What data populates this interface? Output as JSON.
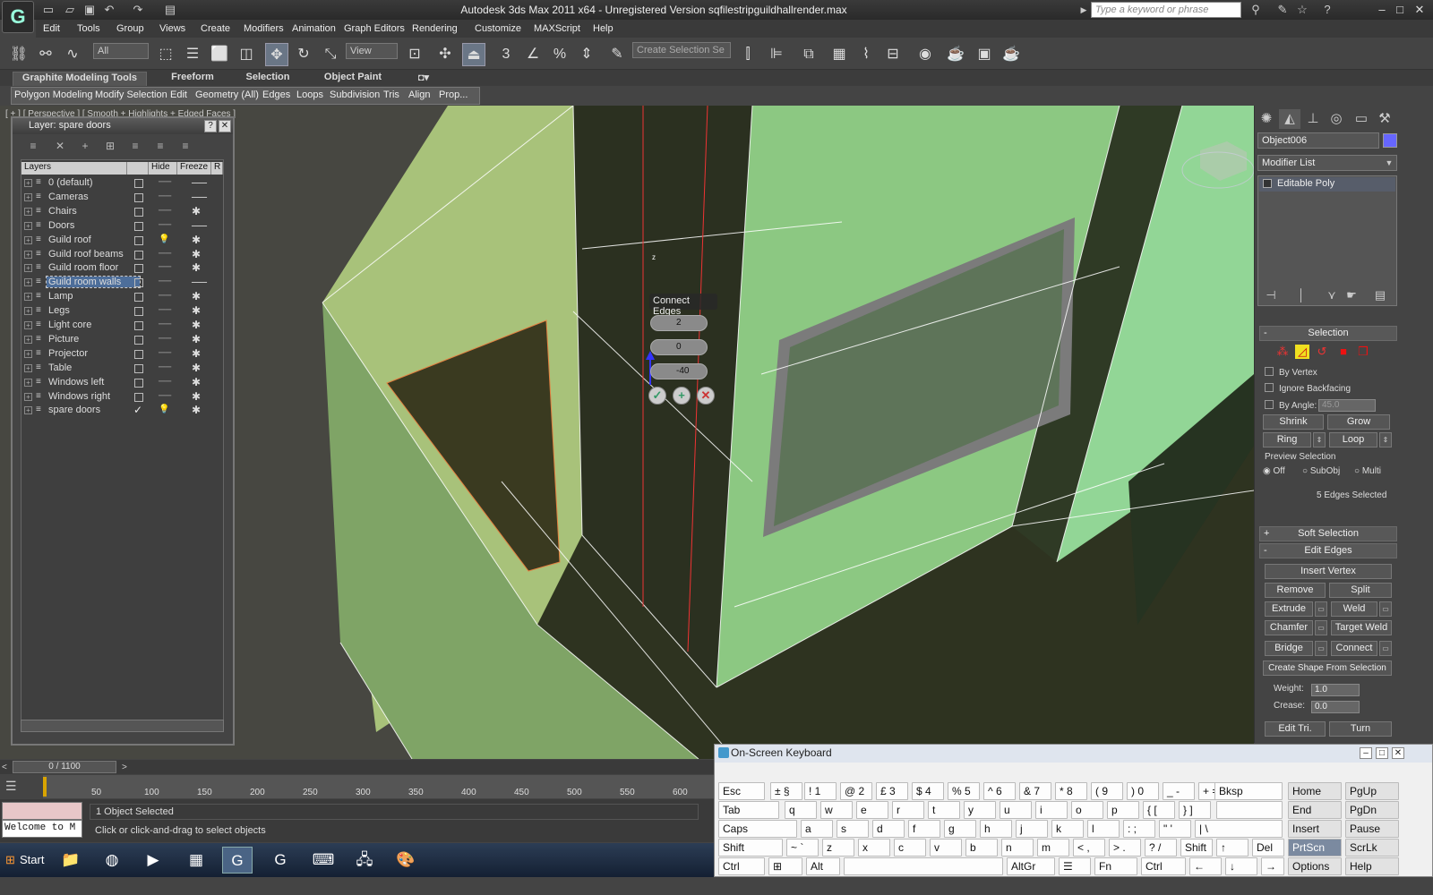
{
  "titlebar": {
    "title": "Autodesk 3ds Max  2011 x64  - Unregistered Version   sqfilestripguildhallrender.max",
    "search_placeholder": "Type a keyword or phrase",
    "logo": "3ds-max-logo",
    "min": "–",
    "max": "□",
    "close": "✕"
  },
  "menu": [
    "Edit",
    "Tools",
    "Group",
    "Views",
    "Create",
    "Modifiers",
    "Animation",
    "Graph Editors",
    "Rendering",
    "Customize",
    "MAXScript",
    "Help"
  ],
  "toolbar": {
    "selection_filter": "All",
    "ref_coord": "View",
    "named_selection_placeholder": "Create Selection Se"
  },
  "ribbon": {
    "tabs": [
      "Graphite Modeling Tools",
      "Freeform",
      "Selection",
      "Object Paint"
    ],
    "panels": [
      "Polygon Modeling",
      "Modify Selection",
      "Edit",
      "Geometry (All)",
      "Edges",
      "Loops",
      "Subdivision",
      "Tris",
      "Align",
      "Prop..."
    ]
  },
  "viewport": {
    "label": "[ + ] [ Perspective ] [ Smooth + Highlights + Edged Faces ]",
    "gizmo_axis": "z",
    "caddy": {
      "title": "Connect Edges",
      "segments": "2",
      "pinch": "0",
      "slide": "-40"
    }
  },
  "layer_dialog": {
    "title": "Layer: spare doors",
    "help": "?",
    "close": "✕",
    "columns": [
      "Layers",
      "",
      "Hide",
      "Freeze",
      "R"
    ],
    "layers": [
      {
        "name": "0 (default)",
        "hide": "──",
        "freeze": "──",
        "current": false
      },
      {
        "name": "Cameras",
        "hide": "──",
        "freeze": "──",
        "current": false
      },
      {
        "name": "Chairs",
        "hide": "──",
        "freeze": "✱",
        "current": false
      },
      {
        "name": "Doors",
        "hide": "──",
        "freeze": "──",
        "current": false
      },
      {
        "name": "Guild roof",
        "hide": "💡",
        "freeze": "✱",
        "current": false
      },
      {
        "name": "Guild roof beams",
        "hide": "──",
        "freeze": "✱",
        "current": false
      },
      {
        "name": "Guild room floor",
        "hide": "──",
        "freeze": "✱",
        "current": false
      },
      {
        "name": "Guild room walls",
        "hide": "──",
        "freeze": "──",
        "current": false,
        "selected": true
      },
      {
        "name": "Lamp",
        "hide": "──",
        "freeze": "✱",
        "current": false
      },
      {
        "name": "Legs",
        "hide": "──",
        "freeze": "✱",
        "current": false
      },
      {
        "name": "Light core",
        "hide": "──",
        "freeze": "✱",
        "current": false
      },
      {
        "name": "Picture",
        "hide": "──",
        "freeze": "✱",
        "current": false
      },
      {
        "name": "Projector",
        "hide": "──",
        "freeze": "✱",
        "current": false
      },
      {
        "name": "Table",
        "hide": "──",
        "freeze": "✱",
        "current": false
      },
      {
        "name": "Windows left",
        "hide": "──",
        "freeze": "✱",
        "current": false
      },
      {
        "name": "Windows right",
        "hide": "──",
        "freeze": "✱",
        "current": false
      },
      {
        "name": "spare doors",
        "hide": "💡",
        "freeze": "✱",
        "current": true
      }
    ]
  },
  "command_panel": {
    "object_name": "Object006",
    "object_color": "#6666ff",
    "modifier_list": "Modifier List",
    "stack_item": "Editable Poly",
    "selection": {
      "title": "Selection",
      "by_vertex": "By Vertex",
      "ignore_backfacing": "Ignore Backfacing",
      "by_angle": "By Angle:",
      "angle_value": "45.0",
      "shrink": "Shrink",
      "grow": "Grow",
      "ring": "Ring",
      "loop": "Loop",
      "preview_title": "Preview Selection",
      "preview_off": "Off",
      "preview_subobj": "SubObj",
      "preview_multi": "Multi",
      "status": "5 Edges Selected"
    },
    "soft_selection": "Soft Selection",
    "edit_edges": {
      "title": "Edit Edges",
      "insert_vertex": "Insert Vertex",
      "remove": "Remove",
      "split": "Split",
      "extrude": "Extrude",
      "weld": "Weld",
      "chamfer": "Chamfer",
      "target_weld": "Target Weld",
      "bridge": "Bridge",
      "connect": "Connect",
      "create_shape": "Create Shape From Selection",
      "weight_label": "Weight:",
      "weight_value": "1.0",
      "crease_label": "Crease:",
      "crease_value": "0.0",
      "edit_tri": "Edit Tri.",
      "turn": "Turn"
    }
  },
  "timeline": {
    "frame": "0 / 1100",
    "ticks": [
      "50",
      "100",
      "150",
      "200",
      "250",
      "300",
      "350",
      "400",
      "450",
      "500",
      "550",
      "600"
    ],
    "status": "1 Object Selected",
    "prompt": "Click or click-and-drag to select objects",
    "listener": "Welcome to M"
  },
  "taskbar": {
    "start": "Start"
  },
  "osk": {
    "title": "On-Screen Keyboard",
    "rows": [
      [
        "Esc",
        "± §",
        "! 1",
        "@ 2",
        "£ 3",
        "$ 4",
        "% 5",
        "^ 6",
        "& 7",
        "* 8",
        "( 9",
        ") 0",
        "_ -",
        "+ =",
        "Bksp",
        "Home",
        "PgUp"
      ],
      [
        "Tab",
        "q",
        "w",
        "e",
        "r",
        "t",
        "y",
        "u",
        "i",
        "o",
        "p",
        "{ [",
        "} ]",
        "",
        "End",
        "PgDn"
      ],
      [
        "Caps",
        "a",
        "s",
        "d",
        "f",
        "g",
        "h",
        "j",
        "k",
        "l",
        ": ;",
        "\" '",
        "| \\",
        "Insert",
        "Pause"
      ],
      [
        "Shift",
        "~ `",
        "z",
        "x",
        "c",
        "v",
        "b",
        "n",
        "m",
        "< ,",
        "> .",
        "? /",
        "Shift",
        "↑",
        "Del",
        "PrtScn",
        "ScrLk"
      ],
      [
        "Ctrl",
        "⊞",
        "Alt",
        "",
        "AltGr",
        "☰",
        "Fn",
        "Ctrl",
        "←",
        "↓",
        "→",
        "Options",
        "Help"
      ]
    ]
  }
}
